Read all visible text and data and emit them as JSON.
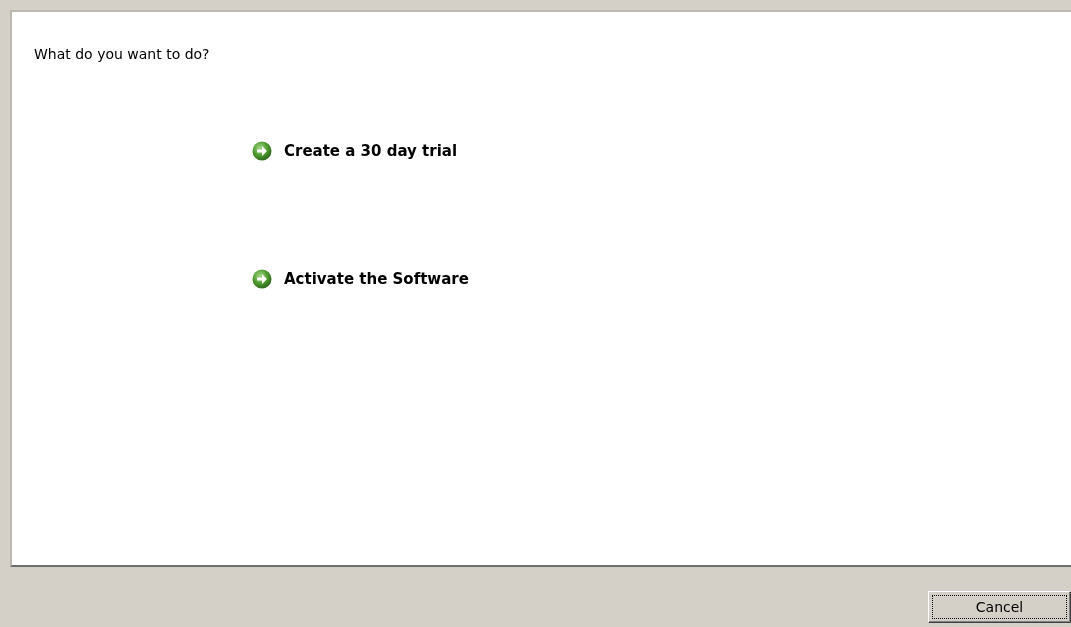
{
  "prompt": "What do you want to do?",
  "options": [
    {
      "label": "Create a 30 day trial"
    },
    {
      "label": "Activate the Software"
    }
  ],
  "buttons": [
    {
      "label": "Cancel",
      "focused": true
    }
  ]
}
